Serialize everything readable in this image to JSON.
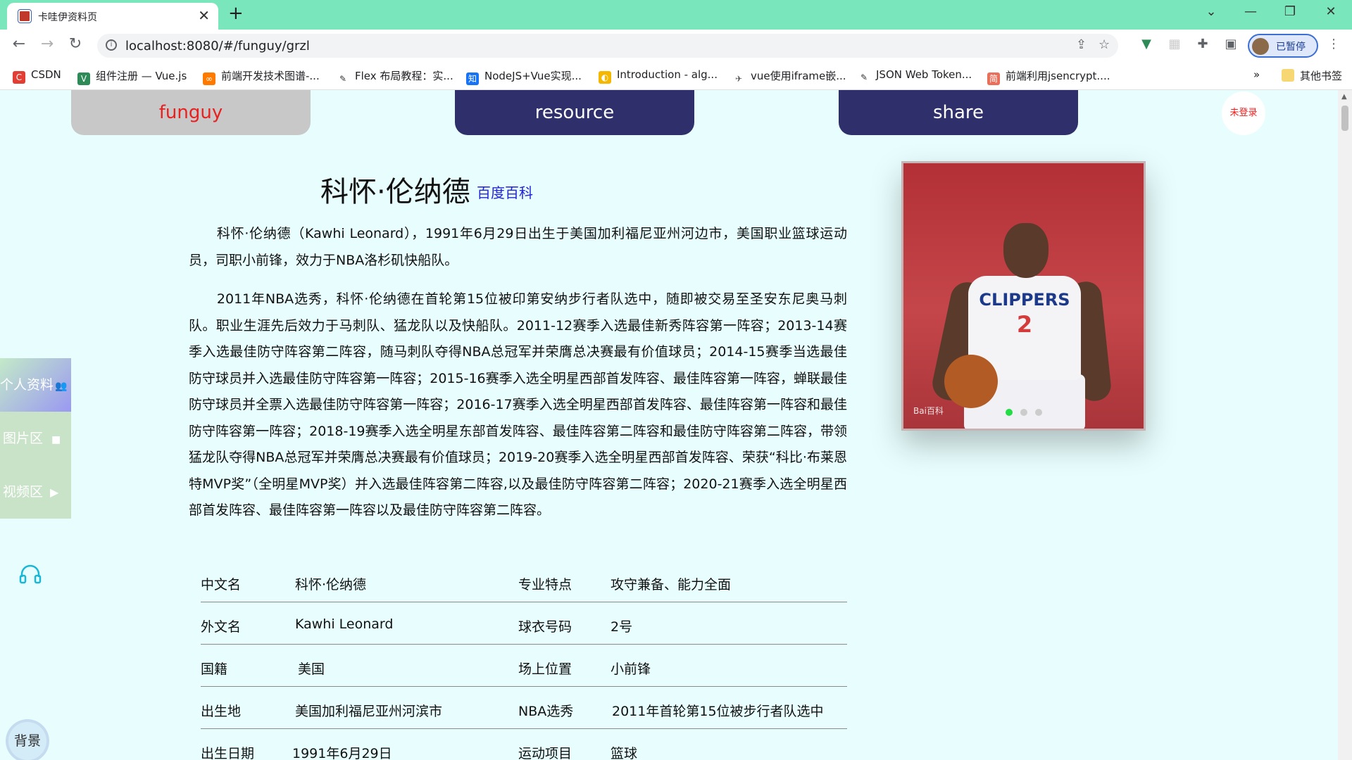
{
  "browser": {
    "tab_title": "卡哇伊资料页",
    "url": "localhost:8080/#/funguy/grzl",
    "profile_label": "已暂停",
    "bookmarks": [
      {
        "label": "CSDN",
        "icon": "csdn-icon",
        "color": "#e33e33"
      },
      {
        "label": "组件注册 — Vue.js",
        "icon": "vue-icon",
        "color": "#2e8b57"
      },
      {
        "label": "前端开发技术图谱-...",
        "icon": "link-icon",
        "color": "#ff7a00"
      },
      {
        "label": "Flex 布局教程：实...",
        "icon": "feather-icon",
        "color": "#333333"
      },
      {
        "label": "NodeJS+Vue实现...",
        "icon": "zhihu-icon",
        "color": "#1772f6"
      },
      {
        "label": "Introduction - alg...",
        "icon": "algolia-icon",
        "color": "#f5b800"
      },
      {
        "label": "vue使用iframe嵌...",
        "icon": "bird-icon",
        "color": "#555555"
      },
      {
        "label": "JSON Web Token...",
        "icon": "feather-icon",
        "color": "#333333"
      },
      {
        "label": "前端利用jsencrypt....",
        "icon": "jianshu-icon",
        "color": "#ea6f5a"
      }
    ],
    "more_bookmarks": "»",
    "other_bookmarks": "其他书签"
  },
  "nav": {
    "funguy": "funguy",
    "resource": "resource",
    "share": "share",
    "login_status": "未登录"
  },
  "profile": {
    "name": "科怀·伦纳德",
    "baike_link": "百度百科",
    "paragraph1": "科怀·伦纳德（Kawhi Leonard），1991年6月29日出生于美国加利福尼亚州河边市，美国职业篮球运动员，司职小前锋，效力于NBA洛杉矶快船队。",
    "paragraph2": "2011年NBA选秀，科怀·伦纳德在首轮第15位被印第安纳步行者队选中，随即被交易至圣安东尼奥马刺队。职业生涯先后效力于马刺队、猛龙队以及快船队。2011-12赛季入选最佳新秀阵容第一阵容；2013-14赛季入选最佳防守阵容第二阵容，随马刺队夺得NBA总冠军并荣膺总决赛最有价值球员；2014-15赛季当选最佳防守球员并入选最佳防守阵容第一阵容；2015-16赛季入选全明星西部首发阵容、最佳阵容第一阵容，蝉联最佳防守球员并全票入选最佳防守阵容第一阵容；2016-17赛季入选全明星西部首发阵容、最佳阵容第一阵容和最佳防守阵容第一阵容；2018-19赛季入选全明星东部首发阵容、最佳阵容第二阵容和最佳防守阵容第二阵容，带领猛龙队夺得NBA总冠军并荣膺总决赛最有价值球员；2019-20赛季入选全明星西部首发阵容、荣获“科比·布莱恩特MVP奖”（全明星MVP奖）并入选最佳阵容第二阵容,以及最佳防守阵容第二阵容；2020-21赛季入选全明星西部首发阵容、最佳阵容第一阵容以及最佳防守阵容第二阵容。",
    "info_rows": [
      {
        "k1": "中文名",
        "v1": "科怀·伦纳德",
        "k2": "专业特点",
        "v2": "攻守兼备、能力全面"
      },
      {
        "k1": "外文名",
        "v1": "Kawhi Leonard",
        "k2": "球衣号码",
        "v2": "2号"
      },
      {
        "k1": "国籍",
        "v1": "美国",
        "k2": "场上位置",
        "v2": "小前锋"
      },
      {
        "k1": "出生地",
        "v1": "美国加利福尼亚州河滨市",
        "k2": "NBA选秀",
        "v2": "2011年首轮第15位被步行者队选中"
      },
      {
        "k1": "出生日期",
        "v1": "1991年6月29日",
        "k2": "运动项目",
        "v2": "篮球"
      }
    ]
  },
  "photo": {
    "jersey_text": "CLIPPERS",
    "jersey_number": "2",
    "watermark": "Bai百科",
    "carousel_active": 0,
    "carousel_count": 3,
    "active_dot_color": "#22dd44"
  },
  "side_menu": {
    "profile": "个人资料",
    "pictures": "图片区",
    "videos": "视频区",
    "background_button": "背景"
  }
}
